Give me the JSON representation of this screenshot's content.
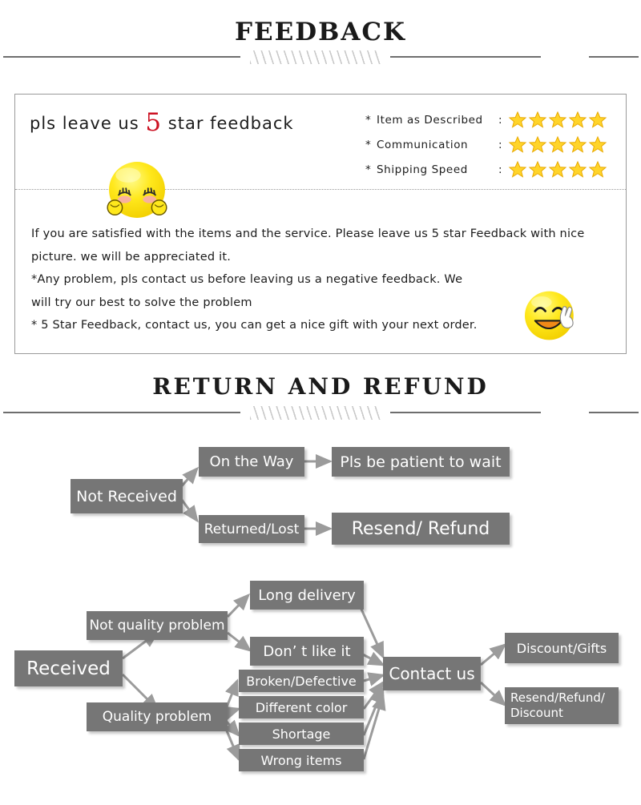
{
  "sections": {
    "feedback_title": "FEEDBACK",
    "return_title": "RETURN  AND  REFUND"
  },
  "feedback": {
    "headline_before": "pls leave us ",
    "headline_number": "5",
    "headline_after": " star feedback",
    "ratings": [
      {
        "mark": "*",
        "label": "Item as Described",
        "colon": ":",
        "stars": 5
      },
      {
        "mark": "*",
        "label": "Communication",
        "colon": ":",
        "stars": 5
      },
      {
        "mark": "*",
        "label": "Shipping Speed",
        "colon": ":",
        "stars": 5
      }
    ],
    "body_lines": [
      "If you are satisfied with the items and the service. Please leave us 5 star Feedback with nice",
      "picture. we will be appreciated it.",
      "*Any problem, pls contact us before leaving us a negative feedback. We",
      "will try our best to solve  the problem",
      "* 5 Star Feedback, contact us, you can get a nice gift with your next order."
    ],
    "emoji_shy_name": "shy-blushing-emoji",
    "emoji_happy_name": "happy-peace-sign-emoji"
  },
  "flow": {
    "nodes": {
      "not_received": "Not Received",
      "on_the_way": "On the Way",
      "pls_be_patient": "Pls be patient to wait",
      "returned_lost": "Returned/Lost",
      "resend_refund": "Resend/ Refund",
      "received": "Received",
      "not_quality_problem": "Not quality problem",
      "long_delivery": "Long delivery",
      "dont_like_it": "Don’ t like it",
      "quality_problem": "Quality problem",
      "broken_defective": "Broken/Defective",
      "different_color": "Different color",
      "shortage": "Shortage",
      "wrong_items": "Wrong items",
      "contact_us": "Contact us",
      "discount_gifts": "Discount/Gifts",
      "resend_refund_discount_line1": "Resend/Refund/",
      "resend_refund_discount_line2": "Discount"
    }
  },
  "colors": {
    "node_bg": "#767676",
    "node_text": "#ffffff",
    "arrow": "#9b9b9b",
    "star": "#ffd42a",
    "star_outline": "#e8a900",
    "accent_red": "#cc1122",
    "divider": "#6e6e6e",
    "emoji_yellow": "#ffe81c",
    "emoji_blush": "#f7a8b8",
    "emoji_mouth": "#f08a18"
  }
}
